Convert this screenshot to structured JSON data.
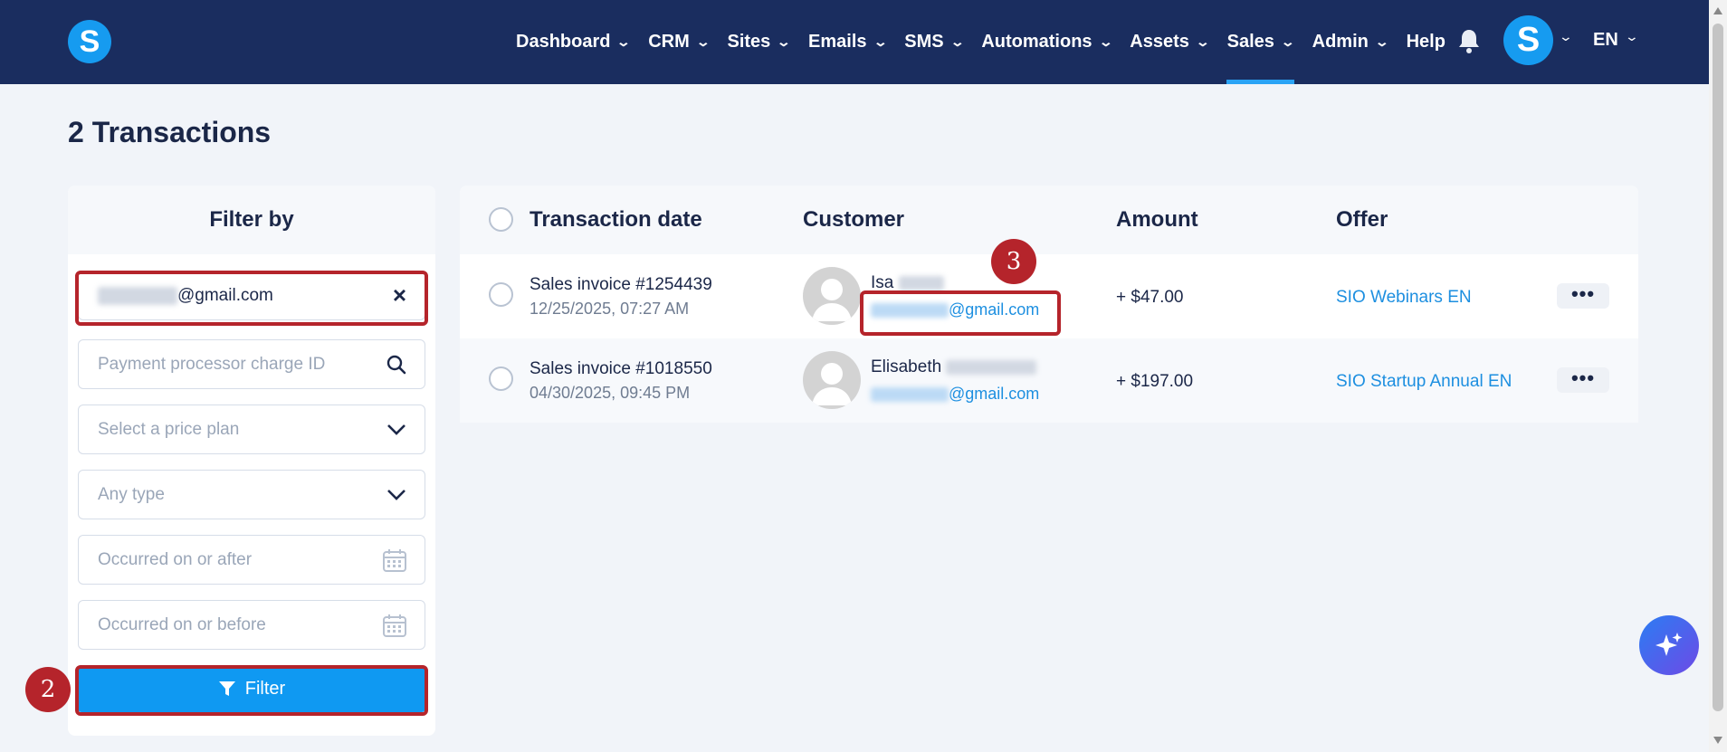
{
  "brand": {
    "logo_letter": "S",
    "accent_color": "#169bf0",
    "nav_bg": "#1a2d5f"
  },
  "nav": {
    "items": [
      {
        "label": "Dashboard",
        "has_dropdown": true
      },
      {
        "label": "CRM",
        "has_dropdown": true
      },
      {
        "label": "Sites",
        "has_dropdown": true
      },
      {
        "label": "Emails",
        "has_dropdown": true
      },
      {
        "label": "SMS",
        "has_dropdown": true
      },
      {
        "label": "Automations",
        "has_dropdown": true
      },
      {
        "label": "Assets",
        "has_dropdown": true
      },
      {
        "label": "Sales",
        "has_dropdown": true,
        "active": true
      },
      {
        "label": "Admin",
        "has_dropdown": true
      },
      {
        "label": "Help",
        "has_dropdown": false
      }
    ],
    "notifications_icon": "bell-icon",
    "user_avatar_letter": "S",
    "language": "EN"
  },
  "page": {
    "title": "2 Transactions"
  },
  "filter": {
    "heading": "Filter by",
    "email_value": "@gmail.com",
    "charge_id_placeholder": "Payment processor charge ID",
    "price_plan_placeholder": "Select a price plan",
    "type_placeholder": "Any type",
    "after_placeholder": "Occurred on or after",
    "before_placeholder": "Occurred on or before",
    "button_label": "Filter"
  },
  "annotations": {
    "filter_step": "2",
    "email_step": "3"
  },
  "table": {
    "headers": {
      "date": "Transaction date",
      "customer": "Customer",
      "amount": "Amount",
      "offer": "Offer"
    },
    "rows": [
      {
        "invoice": "Sales invoice #1254439",
        "date": "12/25/2025, 07:27 AM",
        "customer_name": "Isa",
        "customer_email": "@gmail.com",
        "amount": "+ $47.00",
        "offer": "SIO Webinars EN"
      },
      {
        "invoice": "Sales invoice #1018550",
        "date": "04/30/2025, 09:45 PM",
        "customer_name": "Elisabeth",
        "customer_email": "@gmail.com",
        "amount": "+ $197.00",
        "offer": "SIO Startup Annual EN"
      }
    ]
  }
}
